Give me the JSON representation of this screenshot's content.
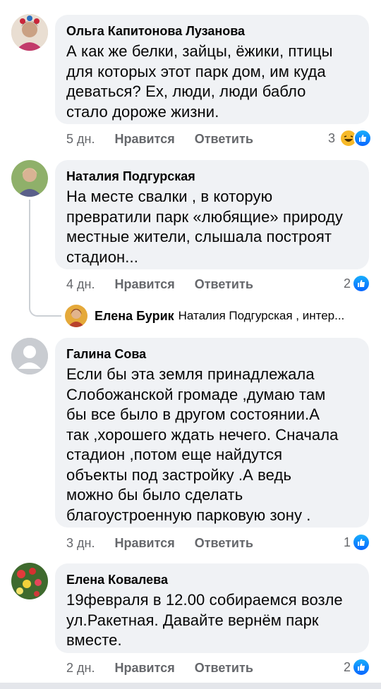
{
  "comments": [
    {
      "author": "Ольга Капитонова Лузанова",
      "lines": [
        "А как же белки, зайцы, ёжики, птицы",
        "для которых этот парк дом, им куда",
        "деваться? Ех, люди, люди бабло",
        "стало дороже жизни."
      ],
      "time": "5 дн.",
      "like_label": "Нравится",
      "reply_label": "Ответить",
      "reaction_count": "3",
      "reactions": [
        "haha-icon",
        "like-icon"
      ]
    },
    {
      "author": "Наталия Подгурская",
      "lines": [
        "На месте свалки , в которую",
        "превратили парк «любящие» природу",
        "местные жители, слышала построят",
        "стадион..."
      ],
      "time": "4 дн.",
      "like_label": "Нравится",
      "reply_label": "Ответить",
      "reaction_count": "2",
      "reactions": [
        "like-icon"
      ],
      "reply": {
        "author": "Елена Бурик",
        "preview": "Наталия Подгурская , интер..."
      }
    },
    {
      "author": "Галина Сова",
      "lines": [
        "Если бы эта земля принадлежала",
        "Слобожанской громаде ,думаю там",
        "бы все было в другом состоянии.А",
        "так ,хорошего ждать нечего. Сначала",
        "стадион ,потом еще найдутся",
        "объекты под застройку .А ведь",
        "можно бы было сделать",
        "благоустроенную парковую зону ."
      ],
      "time": "3 дн.",
      "like_label": "Нравится",
      "reply_label": "Ответить",
      "reaction_count": "1",
      "reactions": [
        "like-icon"
      ]
    },
    {
      "author": "Елена Ковалева",
      "lines": [
        "19февраля в 12.00 собираемся возле",
        "ул.Ракетная. Давайте вернём парк",
        "вместе."
      ],
      "time": "2 дн.",
      "like_label": "Нравится",
      "reply_label": "Ответить",
      "reaction_count": "2",
      "reactions": [
        "like-icon"
      ]
    }
  ],
  "colors": {
    "bubble": "#f0f2f5",
    "secondary_text": "#65676b",
    "like_blue": "#0866ff"
  }
}
